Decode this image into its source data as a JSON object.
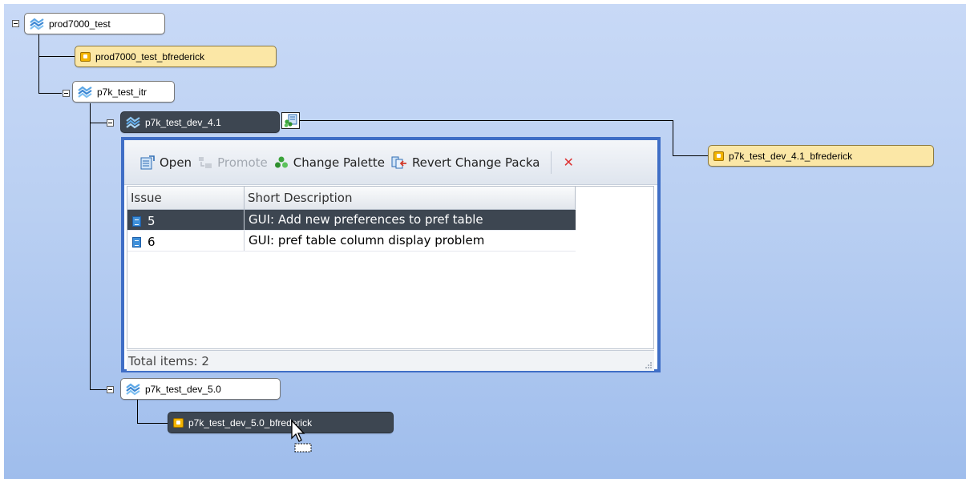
{
  "tree": {
    "root": {
      "label": "prod7000_test",
      "icon": "stream-icon"
    },
    "ws_prod": {
      "label": "prod7000_test_bfrederick",
      "icon": "workspace-icon"
    },
    "itr": {
      "label": "p7k_test_itr",
      "icon": "stream-icon"
    },
    "dev41": {
      "label": "p7k_test_dev_4.1",
      "icon": "stream-icon"
    },
    "ws_dev41": {
      "label": "p7k_test_dev_4.1_bfrederick",
      "icon": "workspace-icon"
    },
    "dev50": {
      "label": "p7k_test_dev_5.0",
      "icon": "stream-icon"
    },
    "ws_dev50": {
      "label": "p7k_test_dev_5.0_bfrederick",
      "icon": "workspace-icon"
    }
  },
  "popup": {
    "toolbar": {
      "open": "Open",
      "promote": "Promote",
      "change_palette": "Change Palette",
      "revert": "Revert Change Packa"
    },
    "columns": [
      "Issue",
      "Short Description"
    ],
    "rows": [
      {
        "issue": "5",
        "description": "GUI: Add new preferences to pref table",
        "selected": true
      },
      {
        "issue": "6",
        "description": "GUI: pref table column display problem",
        "selected": false
      }
    ],
    "status": "Total items: 2"
  },
  "colors": {
    "accent": "#3f6ec6",
    "selection": "#3d4651",
    "workspace": "#fbe7a6"
  }
}
